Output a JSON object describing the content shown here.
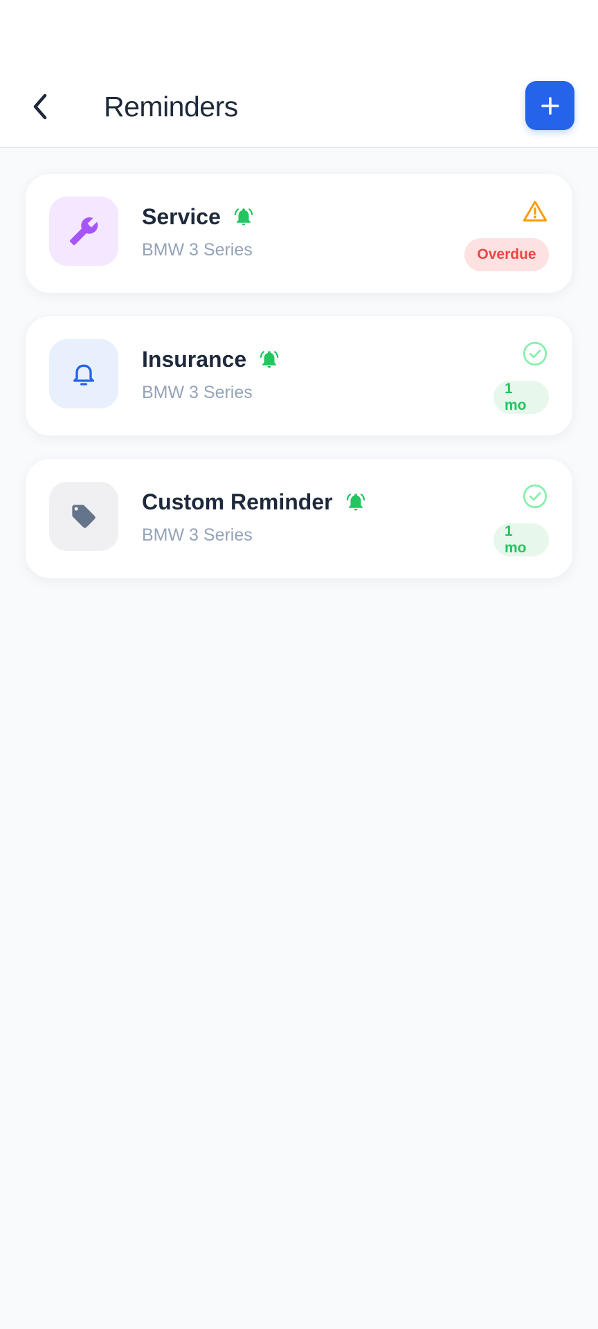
{
  "header": {
    "title": "Reminders",
    "back_icon": "chevron-left-icon",
    "add_icon": "plus-icon",
    "accent": "#2563eb"
  },
  "reminders": [
    {
      "title": "Service",
      "vehicle": "BMW 3 Series",
      "icon": "wrench-icon",
      "tile_bg": "#f3e8ff",
      "icon_color": "#a855f7",
      "status_icon": "warning-icon",
      "status_color": "#f59e0b",
      "badge": "Overdue",
      "badge_bg": "#fee2e2",
      "badge_color": "#ef4444"
    },
    {
      "title": "Insurance",
      "vehicle": "BMW 3 Series",
      "icon": "bell-icon",
      "tile_bg": "#e8effd",
      "icon_color": "#2563eb",
      "status_icon": "check-circle-icon",
      "status_color": "#86efac",
      "badge": "1 mo",
      "badge_bg": "#e8f7ec",
      "badge_color": "#22c55e"
    },
    {
      "title": "Custom Reminder",
      "vehicle": "BMW 3 Series",
      "icon": "tag-icon",
      "tile_bg": "#f0f0f2",
      "icon_color": "#64748b",
      "status_icon": "check-circle-icon",
      "status_color": "#86efac",
      "badge": "1 mo",
      "badge_bg": "#e8f7ec",
      "badge_color": "#22c55e"
    }
  ],
  "alarm_icon": "alarm-bell-icon",
  "alarm_color": "#22c55e"
}
